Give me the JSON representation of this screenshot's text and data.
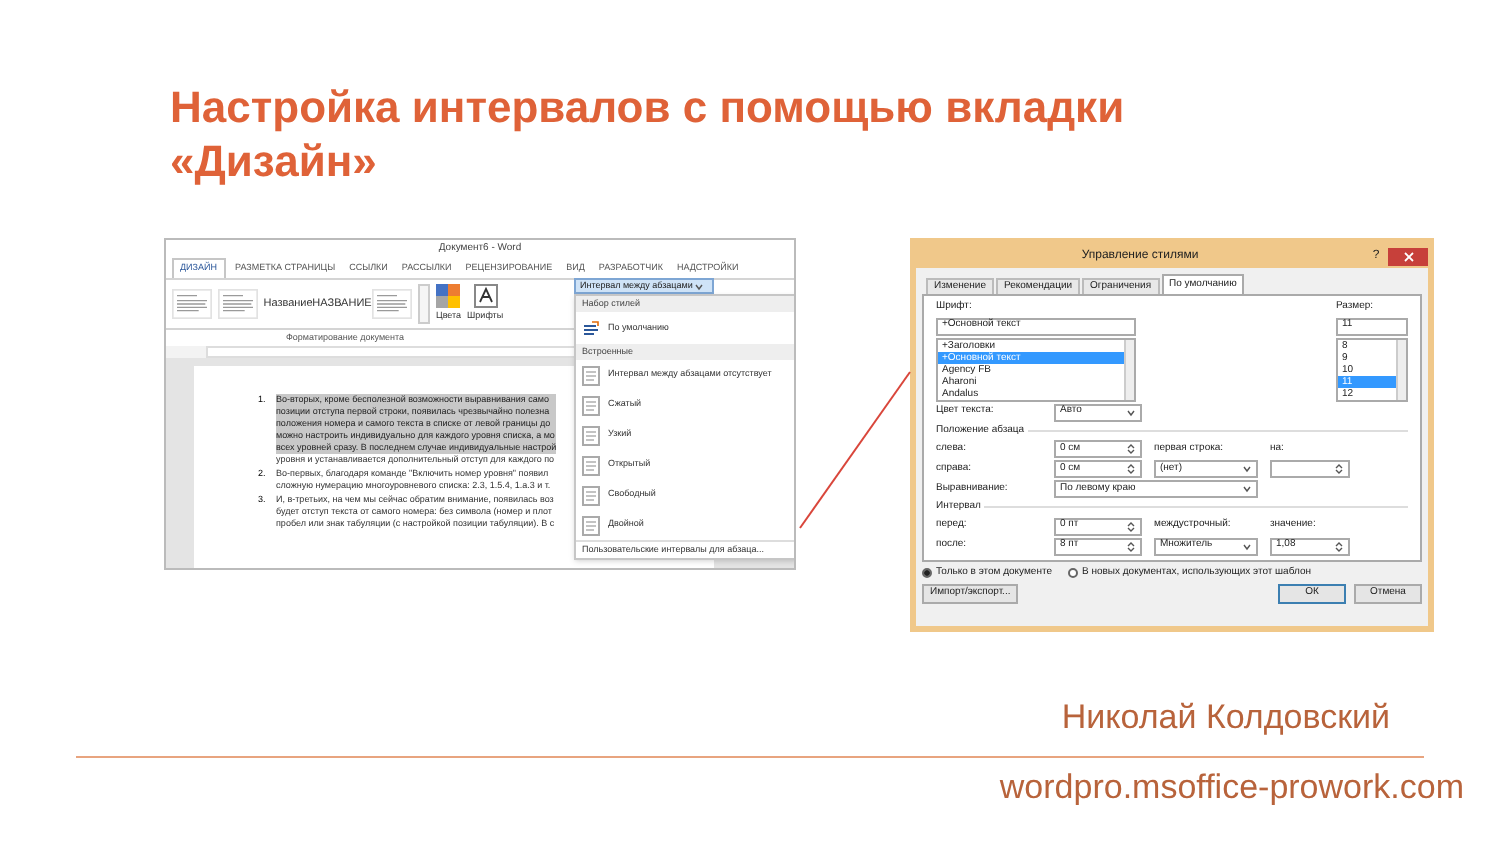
{
  "slide": {
    "title": "Настройка интервалов с помощью вкладки «Дизайн»"
  },
  "word_window": {
    "title": "Документ6 - Word",
    "tabs": [
      {
        "label": "ДИЗАЙН",
        "selected": true
      },
      {
        "label": "РАЗМЕТКА СТРАНИЦЫ",
        "selected": false
      },
      {
        "label": "ССЫЛКИ",
        "selected": false
      },
      {
        "label": "РАССЫЛКИ",
        "selected": false
      },
      {
        "label": "РЕЦЕНЗИРОВАНИЕ",
        "selected": false
      },
      {
        "label": "ВИД",
        "selected": false
      },
      {
        "label": "РАЗРАБОТЧИК",
        "selected": false
      },
      {
        "label": "НАДСТРОЙКИ",
        "selected": false
      }
    ],
    "gallery": [
      {
        "kind": "lines"
      },
      {
        "kind": "lines"
      },
      {
        "kind": "text",
        "label": "Название"
      },
      {
        "kind": "text",
        "label": "НАЗВАНИЕ"
      },
      {
        "kind": "lines"
      }
    ],
    "gallery_caption": "Форматирование документа",
    "theme_buttons": [
      {
        "kind": "colors",
        "label": "Цвета"
      },
      {
        "kind": "fonts",
        "label": "Шрифты"
      }
    ],
    "spacing_button": "Интервал между абзацами",
    "document": [
      {
        "number": "1.",
        "lines": [
          {
            "text": "Во-вторых, кроме бесполезной возможности выравнивания само",
            "selected": true
          },
          {
            "text": "позиции отступа первой строки, появилась чрезвычайно полезна",
            "selected": true
          },
          {
            "text": "положения номера и самого текста в списке от левой границы до",
            "selected": true
          },
          {
            "text": "можно настроить индивидуально для каждого уровня списка, а мо",
            "selected": true
          },
          {
            "text": "всех уровней сразу. В последнем случае индивидуальные настрой",
            "selected": true
          },
          {
            "text": "уровня и устанавливается дополнительный отступ для каждого по",
            "selected": false
          }
        ]
      },
      {
        "number": "2.",
        "lines": [
          {
            "text": "Во-первых, благодаря команде \"Включить номер уровня\" появил",
            "selected": false
          },
          {
            "text": "сложную нумерацию многоуровневого списка: 2.3, 1.5.4, 1.a.3 и т.",
            "selected": false
          }
        ]
      },
      {
        "number": "3.",
        "lines": [
          {
            "text": "И, в-третьих, на чем мы сейчас обратим внимание, появилась воз",
            "selected": false
          },
          {
            "text": "будет отступ текста от самого номера: без символа (номер и плот",
            "selected": false
          },
          {
            "text": "пробел или знак табуляции (с настройкой позиции табуляции). В с",
            "selected": false
          }
        ]
      }
    ],
    "menu": [
      {
        "kind": "header",
        "label": "Набор стилей"
      },
      {
        "kind": "default",
        "label": "По умолчанию"
      },
      {
        "kind": "header",
        "label": "Встроенные"
      },
      {
        "kind": "option",
        "label": "Интервал между абзацами отсутствует"
      },
      {
        "kind": "option",
        "label": "Сжатый"
      },
      {
        "kind": "option",
        "label": "Узкий"
      },
      {
        "kind": "option",
        "label": "Открытый"
      },
      {
        "kind": "option",
        "label": "Свободный"
      },
      {
        "kind": "option",
        "label": "Двойной"
      },
      {
        "kind": "link",
        "label": "Пользовательские интервалы для абзаца..."
      }
    ]
  },
  "dialog": {
    "title": "Управление стилями",
    "help": "?",
    "tabs": [
      {
        "label": "Изменение",
        "selected": false
      },
      {
        "label": "Рекомендации",
        "selected": false
      },
      {
        "label": "Ограничения",
        "selected": false
      },
      {
        "label": "По умолчанию",
        "selected": true
      }
    ],
    "font": {
      "label": "Шрифт:",
      "value": "+Основной текст",
      "options": [
        {
          "label": "+Заголовки",
          "selected": false
        },
        {
          "label": "+Основной текст",
          "selected": true
        },
        {
          "label": "Agency FB",
          "selected": false
        },
        {
          "label": "Aharoni",
          "selected": false
        },
        {
          "label": "Andalus",
          "selected": false
        }
      ]
    },
    "size": {
      "label": "Размер:",
      "value": "11",
      "options": [
        {
          "label": "8",
          "selected": false
        },
        {
          "label": "9",
          "selected": false
        },
        {
          "label": "10",
          "selected": false
        },
        {
          "label": "11",
          "selected": true
        },
        {
          "label": "12",
          "selected": false
        }
      ]
    },
    "color": {
      "label": "Цвет текста:",
      "value": "Авто"
    },
    "paragraph": {
      "heading": "Положение абзаца",
      "left": {
        "label": "слева:",
        "value": "0 см"
      },
      "first_line_label": "первая строка:",
      "by_label": "на:",
      "right": {
        "label": "справа:",
        "value": "0 см"
      },
      "first_line_value": "(нет)",
      "alignment": {
        "label": "Выравнивание:",
        "value": "По левому краю"
      }
    },
    "spacing": {
      "heading": "Интервал",
      "before": {
        "label": "перед:",
        "value": "0 пт"
      },
      "line_label": "междустрочный:",
      "amount_label": "значение:",
      "after": {
        "label": "после:",
        "value": "8 пт"
      },
      "line_value": "Множитель",
      "amount": "1,08"
    },
    "scope": [
      {
        "label": "Только в этом документе",
        "selected": true
      },
      {
        "label": "В новых документах, использующих этот шаблон",
        "selected": false
      }
    ],
    "import_button": "Импорт/экспорт...",
    "ok_button": "ОК",
    "cancel_button": "Отмена"
  },
  "footer": {
    "author": "Николай Колдовский",
    "site": "wordpro.msoffice-prowork.com"
  }
}
